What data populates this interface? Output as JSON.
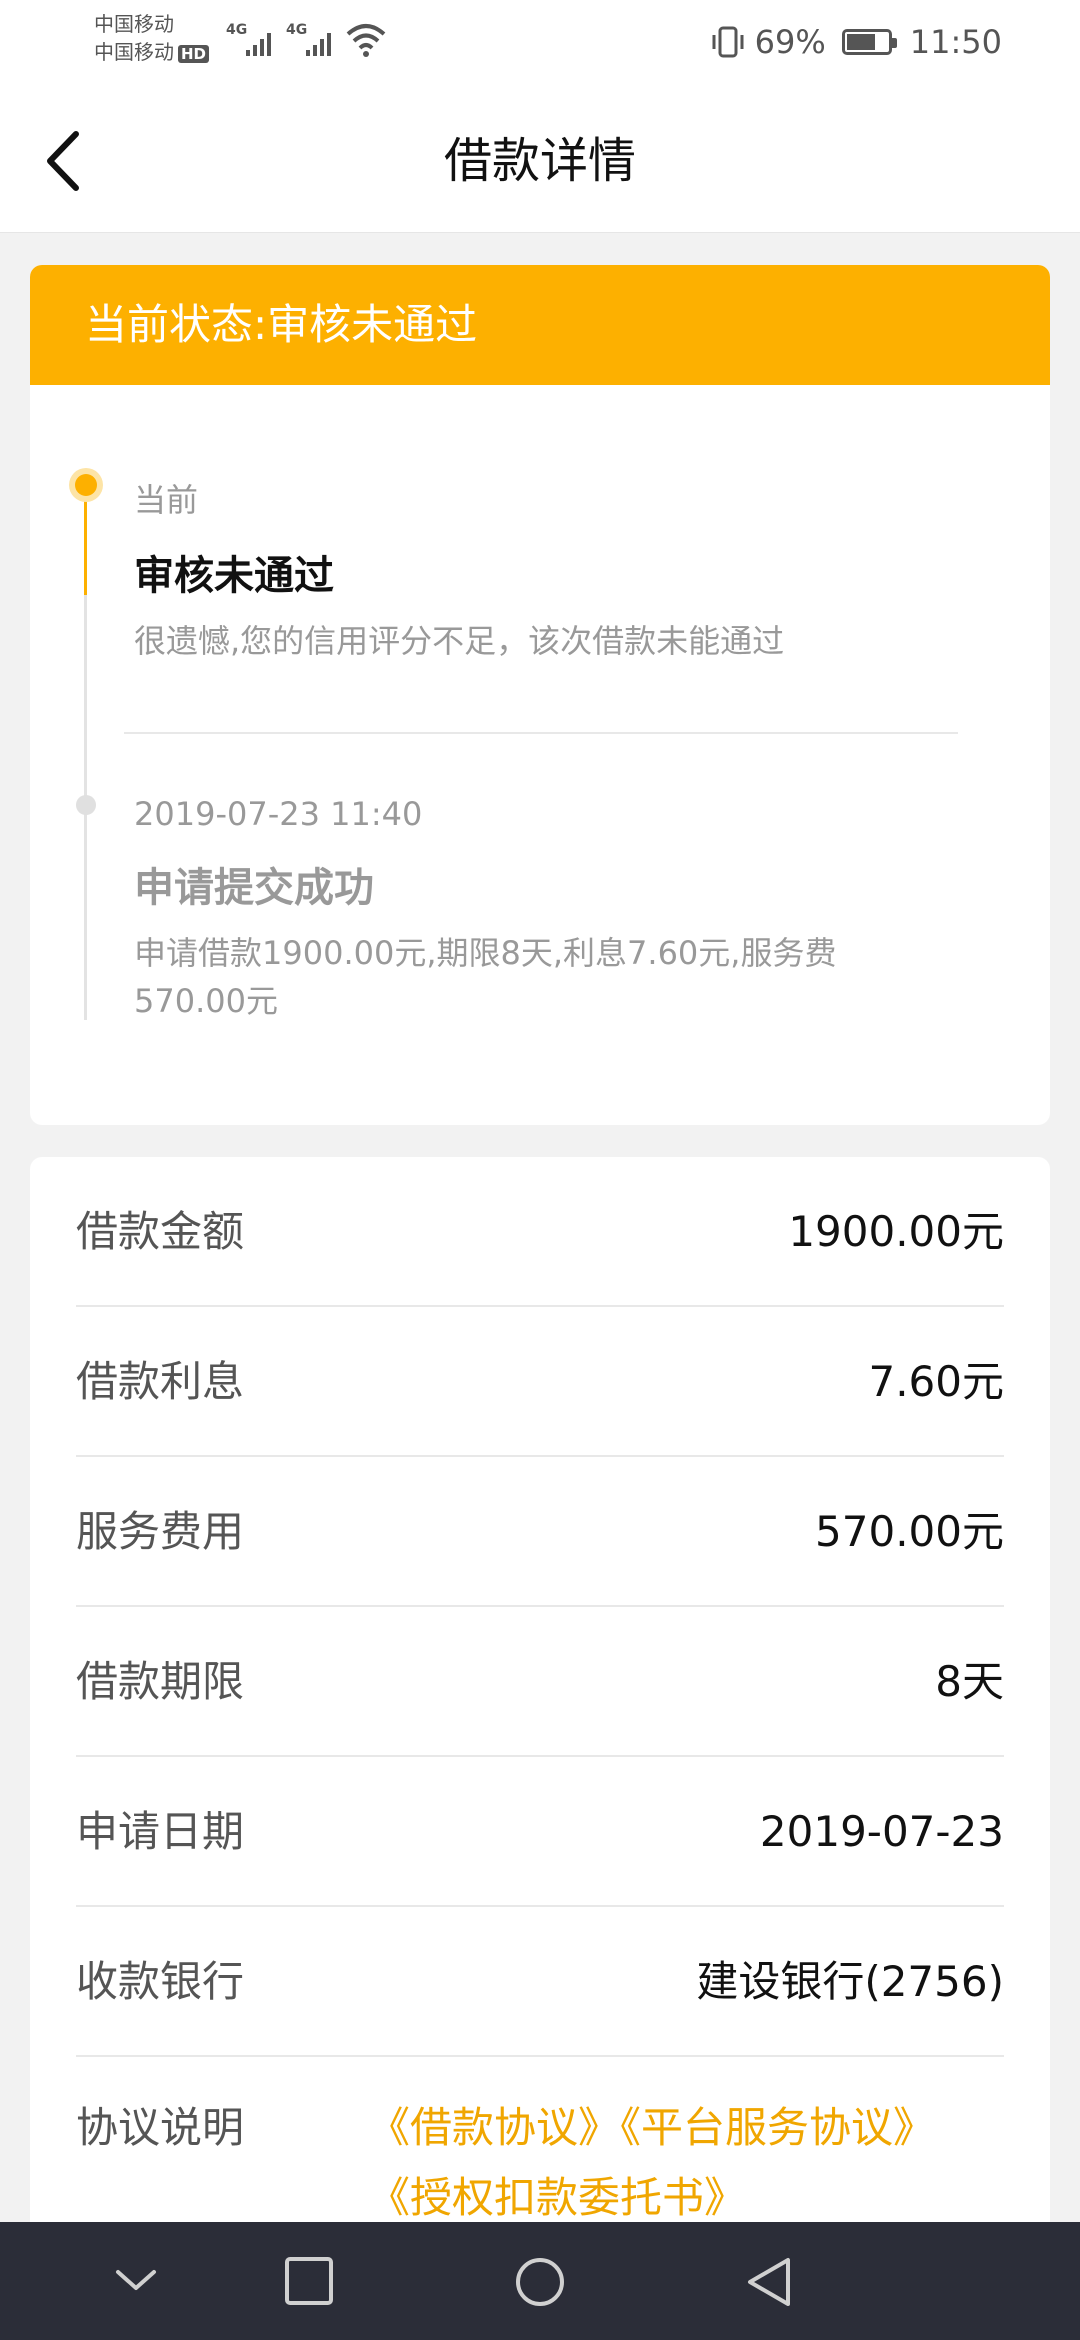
{
  "status_bar": {
    "carrier1": "中国移动",
    "carrier2": "中国移动",
    "hd_badge": "HD",
    "net1": "4G",
    "net2": "4G",
    "battery_text": "69%",
    "battery_level": 0.69,
    "time": "11:50"
  },
  "header": {
    "title": "借款详情"
  },
  "status_banner": "当前状态:审核未通过",
  "timeline": [
    {
      "label": "当前",
      "title": "审核未通过",
      "desc": "很遗憾,您的信用评分不足，该次借款未能通过"
    },
    {
      "label": "2019-07-23 11:40",
      "title": "申请提交成功",
      "desc": "申请借款1900.00元,期限8天,利息7.60元,服务费570.00元"
    }
  ],
  "details": [
    {
      "label": "借款金额",
      "value": "1900.00元"
    },
    {
      "label": "借款利息",
      "value": "7.60元"
    },
    {
      "label": "服务费用",
      "value": "570.00元"
    },
    {
      "label": "借款期限",
      "value": "8天"
    },
    {
      "label": "申请日期",
      "value": "2019-07-23"
    },
    {
      "label": "收款银行",
      "value": "建设银行(2756)"
    }
  ],
  "agreements": {
    "label": "协议说明",
    "links": [
      "《借款协议》",
      "《平台服务协议》",
      "《授权扣款委托书》"
    ]
  },
  "colors": {
    "accent": "#fdb000",
    "link": "#f0a600",
    "navbar": "#2b2d38"
  }
}
